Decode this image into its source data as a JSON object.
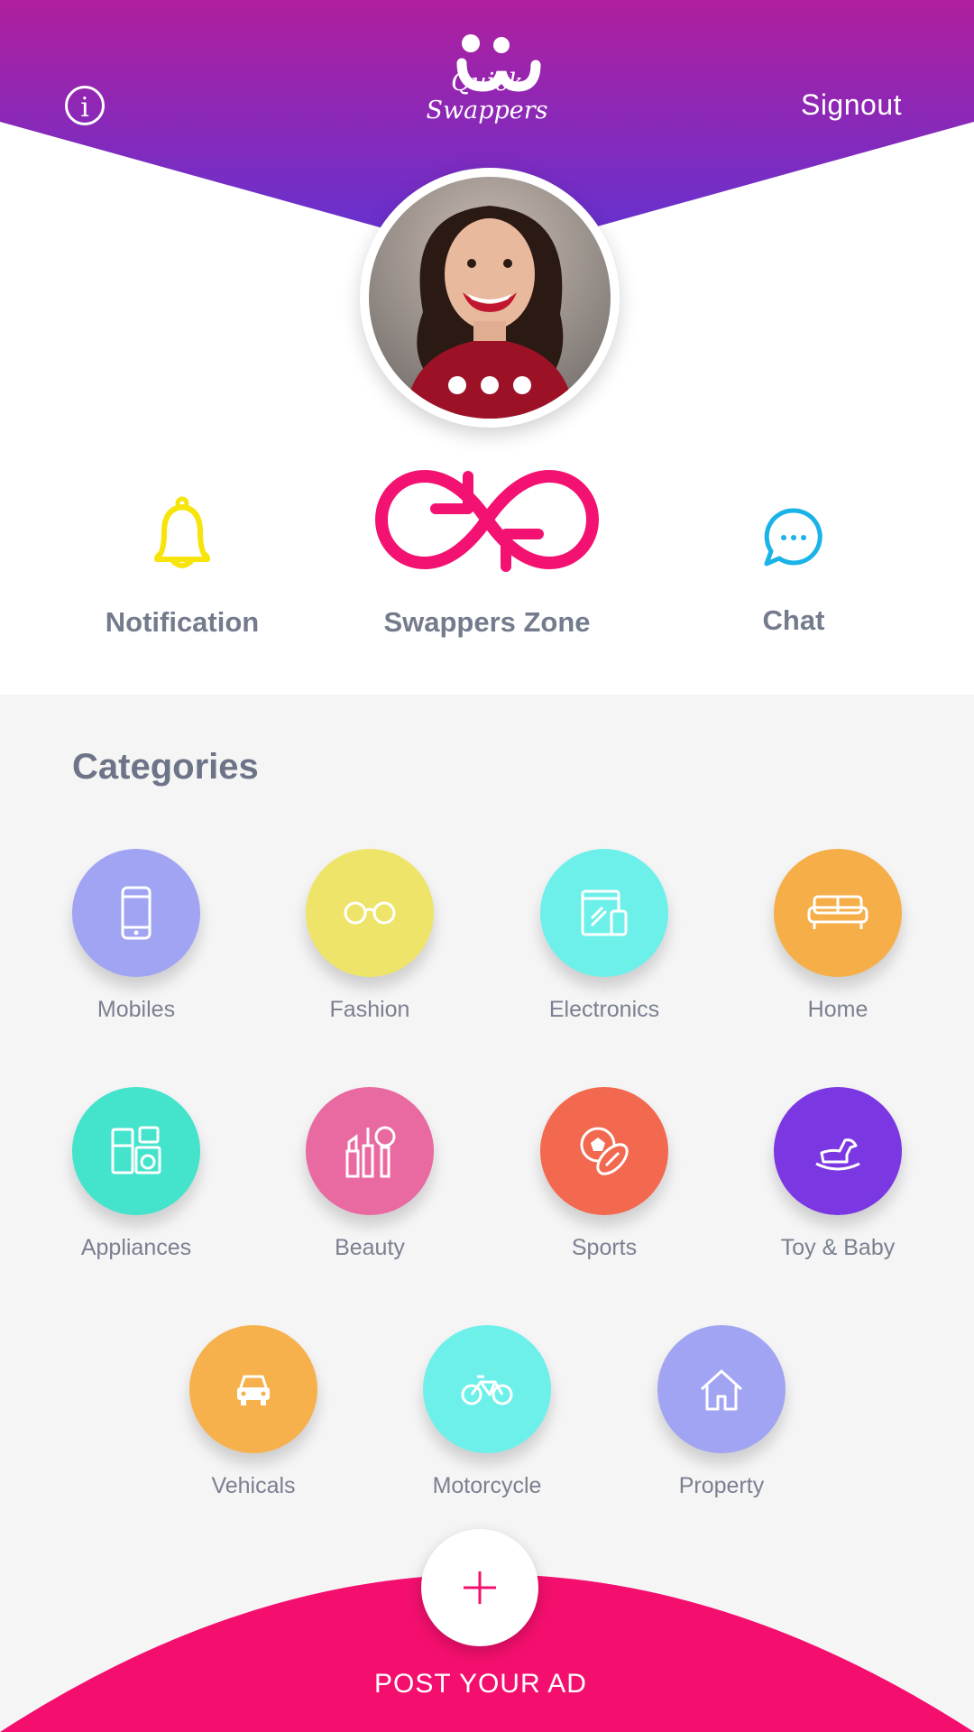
{
  "header": {
    "info_icon": "info-icon",
    "logo_text": "Quick Swappers",
    "signout_label": "Signout",
    "gradient": [
      "#b01f9e",
      "#5f33d4"
    ]
  },
  "profile": {
    "menu_icon": "more-dots-icon"
  },
  "actions": [
    {
      "label": "Notification",
      "icon": "bell-icon",
      "color": "#f7e40a"
    },
    {
      "label": "Swappers Zone",
      "icon": "swap-infinity-icon",
      "color": "#f31271"
    },
    {
      "label": "Chat",
      "icon": "chat-bubble-icon",
      "color": "#1ab3e8"
    }
  ],
  "categories": {
    "title": "Categories",
    "items": [
      {
        "label": "Mobiles",
        "icon": "mobile-phone-icon",
        "color": "#a0a4f2"
      },
      {
        "label": "Fashion",
        "icon": "glasses-icon",
        "color": "#efe46a"
      },
      {
        "label": "Electronics",
        "icon": "devices-icon",
        "color": "#6ef0ea"
      },
      {
        "label": "Home",
        "icon": "sofa-icon",
        "color": "#f6ae48"
      },
      {
        "label": "Appliances",
        "icon": "appliances-icon",
        "color": "#44e3cb"
      },
      {
        "label": "Beauty",
        "icon": "makeup-icon",
        "color": "#e86aa0"
      },
      {
        "label": "Sports",
        "icon": "sports-balls-icon",
        "color": "#f26950"
      },
      {
        "label": "Toy & Baby",
        "icon": "rocking-horse-icon",
        "color": "#7b38e2"
      },
      {
        "label": "Vehicals",
        "icon": "car-icon",
        "color": "#f6b14c"
      },
      {
        "label": "Motorcycle",
        "icon": "bicycle-icon",
        "color": "#6ef0ea"
      },
      {
        "label": "Property",
        "icon": "house-icon",
        "color": "#a0a4f2"
      }
    ]
  },
  "post": {
    "label": "POST YOUR AD",
    "icon": "plus-icon",
    "color": "#f40f6e"
  }
}
